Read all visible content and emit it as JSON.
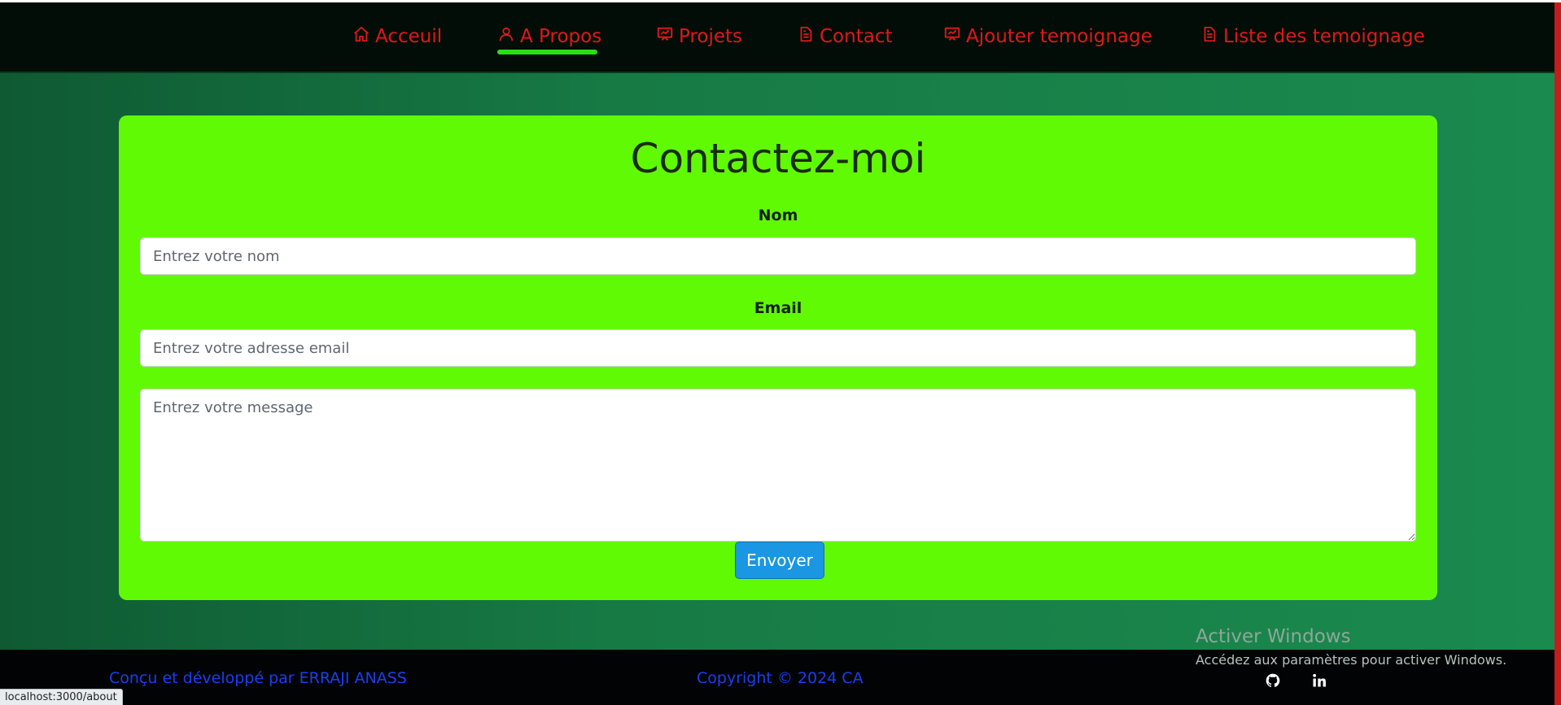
{
  "nav": {
    "items": [
      {
        "label": "Acceuil",
        "icon": "home-icon"
      },
      {
        "label": "A Propos",
        "icon": "user-icon",
        "active": true
      },
      {
        "label": "Projets",
        "icon": "presentation-icon"
      },
      {
        "label": "Contact",
        "icon": "document-icon"
      },
      {
        "label": "Ajouter temoignage",
        "icon": "presentation-icon"
      },
      {
        "label": "Liste des temoignage",
        "icon": "document-icon"
      }
    ]
  },
  "form": {
    "title": "Contactez-moi",
    "name_label": "Nom",
    "name_placeholder": "Entrez votre nom",
    "email_label": "Email",
    "email_placeholder": "Entrez votre adresse email",
    "message_placeholder": "Entrez votre message",
    "submit_label": "Envoyer"
  },
  "footer": {
    "credit": "Conçu et développé par ERRAJI ANASS",
    "copyright": "Copyright © 2024 CA",
    "social": [
      "github-icon",
      "linkedin-icon"
    ]
  },
  "overlay": {
    "activate_title": "Activer Windows",
    "activate_sub": "Accédez aux paramètres pour activer Windows.",
    "status_url": "localhost:3000/about"
  },
  "colors": {
    "nav_bg": "#020d07",
    "nav_text": "#e01818",
    "active_underline": "#27e010",
    "card_bg": "#61fa05",
    "button_bg": "#1a96e3",
    "footer_text": "#1a3ff0"
  }
}
